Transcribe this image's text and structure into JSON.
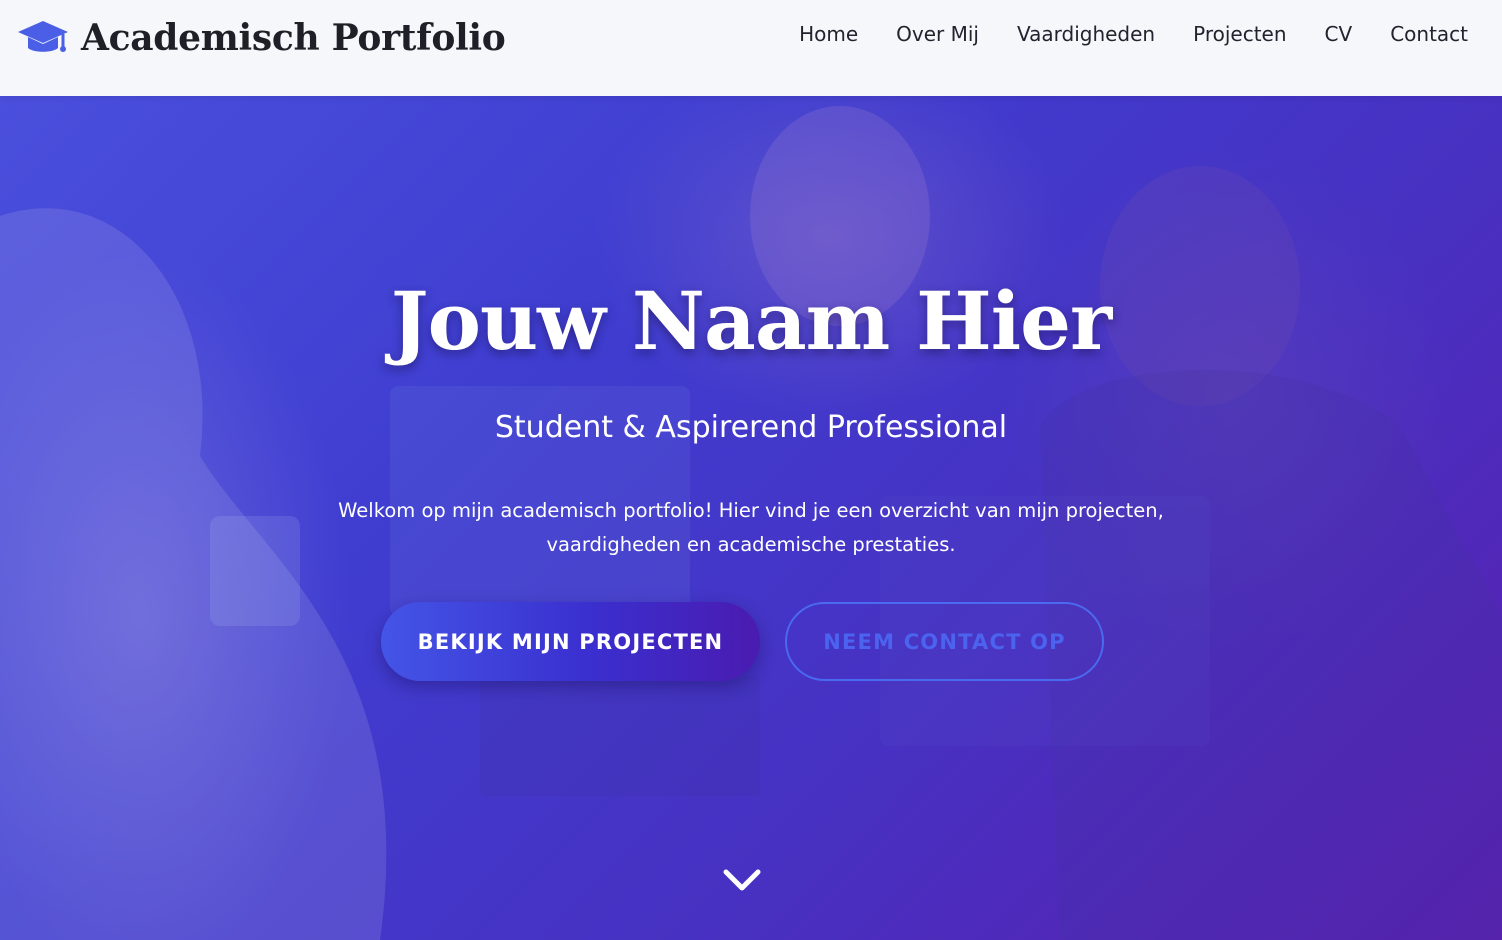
{
  "header": {
    "brand_title": "Academisch Portfolio",
    "brand_icon": "graduation-cap-icon",
    "nav": [
      {
        "label": "Home"
      },
      {
        "label": "Over Mij"
      },
      {
        "label": "Vaardigheden"
      },
      {
        "label": "Projecten"
      },
      {
        "label": "CV"
      },
      {
        "label": "Contact"
      }
    ]
  },
  "hero": {
    "title": "Jouw Naam Hier",
    "subtitle": "Student & Aspirerend Professional",
    "intro_line1": "Welkom op mijn academisch portfolio! Hier vind je een overzicht van mijn projecten,",
    "intro_line2": "vaardigheden en academische prestaties.",
    "primary_button": "BEKIJK MIJN PROJECTEN",
    "secondary_button": "NEEM CONTACT OP",
    "scroll_icon": "chevron-down-icon"
  },
  "colors": {
    "accent": "#4a6af0",
    "hero_gradient_start": "#4a4fdc",
    "hero_gradient_end": "#5a1fb0",
    "header_bg": "#f6f7fb"
  }
}
